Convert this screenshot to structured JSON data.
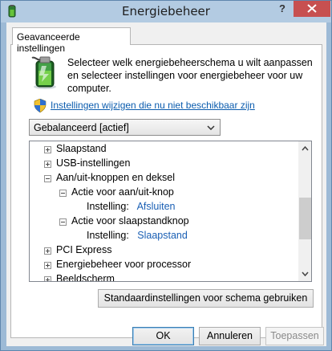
{
  "window": {
    "title": "Energiebeheer",
    "help_label": "?"
  },
  "tab": {
    "label": "Geavanceerde instellingen"
  },
  "intro_text": "Selecteer welk energiebeheerschema u wilt aanpassen en selecteer instellingen voor energiebeheer voor uw computer.",
  "change_link": "Instellingen wijzigen die nu niet beschikbaar zijn",
  "scheme_select": {
    "selected": "Gebalanceerd [actief]"
  },
  "tree": {
    "items": [
      {
        "label": "Slaapstand",
        "expander": "plus"
      },
      {
        "label": "USB-instellingen",
        "expander": "plus"
      },
      {
        "label": "Aan/uit-knoppen en deksel",
        "expander": "minus"
      },
      {
        "label": "Actie voor aan/uit-knop",
        "expander": "minus"
      },
      {
        "label": "Instelling:",
        "value": "Afsluiten"
      },
      {
        "label": "Actie voor slaapstandknop",
        "expander": "minus"
      },
      {
        "label": "Instelling:",
        "value": "Slaapstand"
      },
      {
        "label": "PCI Express",
        "expander": "plus"
      },
      {
        "label": "Energiebeheer voor processor",
        "expander": "plus"
      },
      {
        "label": "Beeldscherm",
        "expander": "plus"
      }
    ]
  },
  "buttons": {
    "reset": "Standaardinstellingen voor schema gebruiken",
    "ok": "OK",
    "cancel": "Annuleren",
    "apply": "Toepassen"
  },
  "icons": {
    "app": "battery-icon",
    "uac": "shield-icon",
    "close": "close-icon"
  },
  "colors": {
    "link": "#0b5cae",
    "close_button": "#c75050",
    "titlebar": "#b3cbe2"
  }
}
